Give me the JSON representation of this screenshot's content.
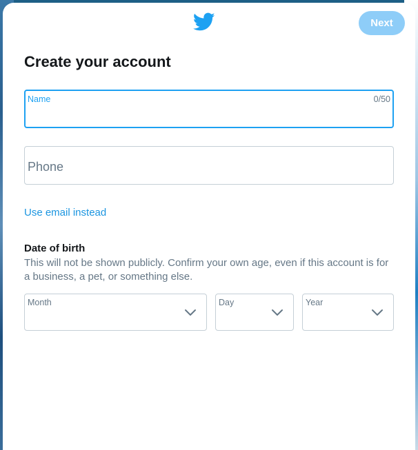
{
  "header": {
    "logo_icon": "twitter-bird-icon",
    "next_label": "Next"
  },
  "title": "Create your account",
  "name_field": {
    "label": "Name",
    "counter": "0/50",
    "value": ""
  },
  "phone_field": {
    "label": "Phone"
  },
  "use_email_link": "Use email instead",
  "dob": {
    "heading": "Date of birth",
    "description": "This will not be shown publicly. Confirm your own age, even if this account is for a business, a pet, or something else.",
    "month_label": "Month",
    "day_label": "Day",
    "year_label": "Year",
    "chevron_icon": "chevron-down-icon"
  },
  "colors": {
    "accent": "#1da1f2",
    "next_button": "#8ecdf8",
    "text": "#14171a",
    "muted": "#657786",
    "link": "#1b95e0",
    "border": "#c4cfd6"
  }
}
